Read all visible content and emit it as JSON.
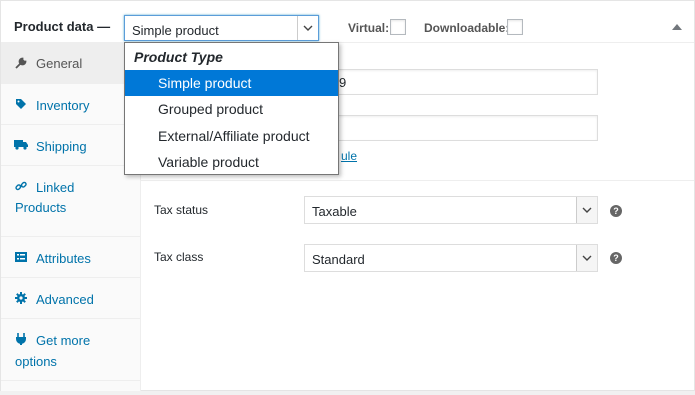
{
  "header": {
    "title": "Product data —",
    "product_type": "Simple product",
    "virtual_label": "Virtual:",
    "downloadable_label": "Downloadable:"
  },
  "dropdown": {
    "group_label": "Product Type",
    "options": [
      "Simple product",
      "Grouped product",
      "External/Affiliate product",
      "Variable product"
    ],
    "selected": "Simple product"
  },
  "sidebar": {
    "items": [
      {
        "label": "General",
        "icon": "wrench-icon"
      },
      {
        "label": "Inventory",
        "icon": "tag-icon"
      },
      {
        "label": "Shipping",
        "icon": "truck-icon"
      },
      {
        "label": "Linked",
        "label2": "Products",
        "icon": "link-icon"
      },
      {
        "label": "Attributes",
        "icon": "list-icon"
      },
      {
        "label": "Advanced",
        "icon": "gear-icon"
      },
      {
        "label": "Get more",
        "label2": "options",
        "icon": "plugin-icon"
      }
    ]
  },
  "general": {
    "regular_price_peek": "9",
    "schedule_link_peek": "ule",
    "tax_status_label": "Tax status",
    "tax_status_value": "Taxable",
    "tax_class_label": "Tax class",
    "tax_class_value": "Standard",
    "help_glyph": "?"
  },
  "colors": {
    "accent": "#0073aa",
    "selection": "#0078d7",
    "focus_border": "#5b9dd9"
  }
}
